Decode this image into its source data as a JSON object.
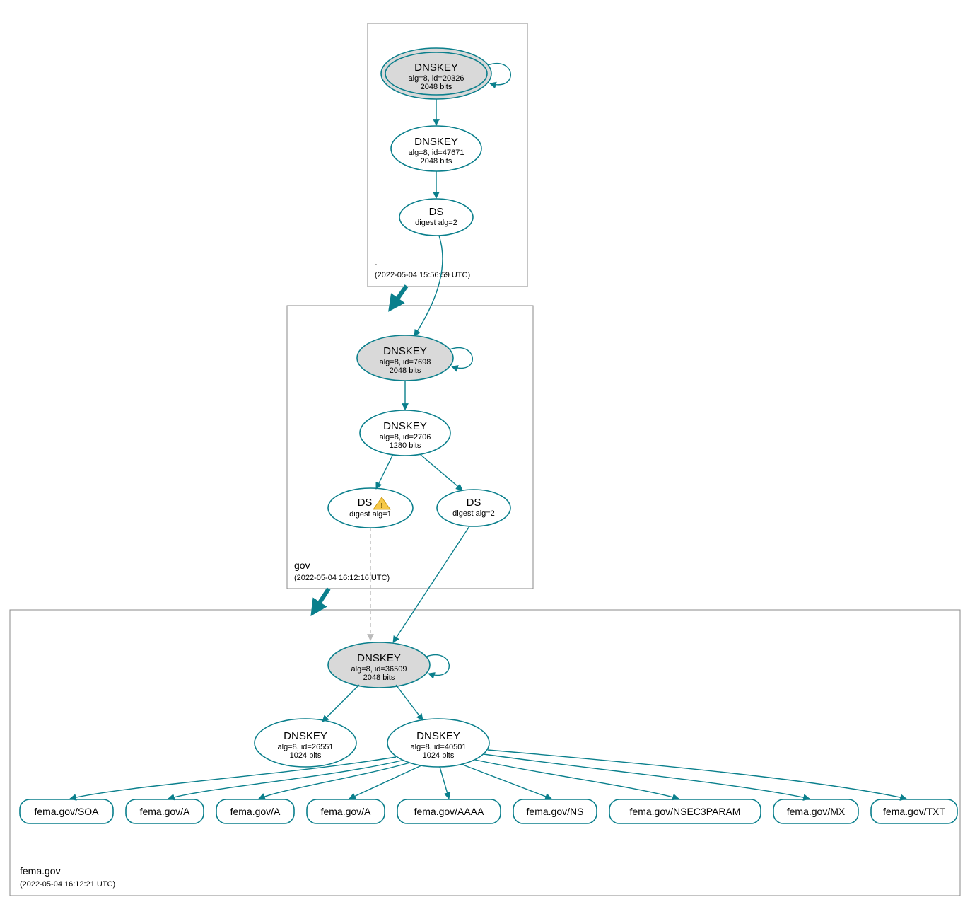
{
  "colors": {
    "teal": "#0a7f8c",
    "kskFill": "#d9d9d9",
    "warn": "#f7c948"
  },
  "zones": {
    "root": {
      "label": ".",
      "timestamp": "(2022-05-04 15:56:59 UTC)"
    },
    "gov": {
      "label": "gov",
      "timestamp": "(2022-05-04 16:12:16 UTC)"
    },
    "fema": {
      "label": "fema.gov",
      "timestamp": "(2022-05-04 16:12:21 UTC)"
    }
  },
  "nodes": {
    "root_ksk": {
      "title": "DNSKEY",
      "line1": "alg=8, id=20326",
      "line2": "2048 bits"
    },
    "root_zsk": {
      "title": "DNSKEY",
      "line1": "alg=8, id=47671",
      "line2": "2048 bits"
    },
    "root_ds": {
      "title": "DS",
      "line1": "digest alg=2",
      "line2": ""
    },
    "gov_ksk": {
      "title": "DNSKEY",
      "line1": "alg=8, id=7698",
      "line2": "2048 bits"
    },
    "gov_zsk": {
      "title": "DNSKEY",
      "line1": "alg=8, id=2706",
      "line2": "1280 bits"
    },
    "gov_ds1": {
      "title": "DS",
      "line1": "digest alg=1",
      "line2": "",
      "warn": true
    },
    "gov_ds2": {
      "title": "DS",
      "line1": "digest alg=2",
      "line2": ""
    },
    "fema_ksk": {
      "title": "DNSKEY",
      "line1": "alg=8, id=36509",
      "line2": "2048 bits"
    },
    "fema_zsk1": {
      "title": "DNSKEY",
      "line1": "alg=8, id=26551",
      "line2": "1024 bits"
    },
    "fema_zsk2": {
      "title": "DNSKEY",
      "line1": "alg=8, id=40501",
      "line2": "1024 bits"
    }
  },
  "rrsets": {
    "r0": "fema.gov/SOA",
    "r1": "fema.gov/A",
    "r2": "fema.gov/A",
    "r3": "fema.gov/A",
    "r4": "fema.gov/AAAA",
    "r5": "fema.gov/NS",
    "r6": "fema.gov/NSEC3PARAM",
    "r7": "fema.gov/MX",
    "r8": "fema.gov/TXT"
  }
}
